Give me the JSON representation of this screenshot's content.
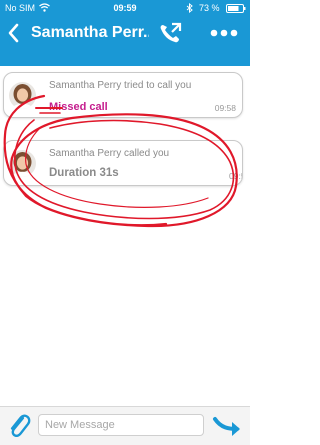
{
  "status": {
    "carrier": "No SIM",
    "time": "09:59",
    "battery": "73 %"
  },
  "header": {
    "title": "Samantha Perr...",
    "accent_color": "#1a98d5"
  },
  "messages": [
    {
      "text": "Samantha Perry tried to call you",
      "status": "Missed call",
      "time": "09:58",
      "status_color": "#c51e8e"
    },
    {
      "text": "Samantha Perry called you",
      "status": "Duration 31s",
      "time": "09:5"
    }
  ],
  "composer": {
    "placeholder": "New Message"
  },
  "icons": {
    "back": "chevron-left-icon",
    "call": "phone-icon",
    "more": "more-dots-icon",
    "attach": "paperclip-icon",
    "send": "send-arrow-icon",
    "wifi": "wifi-icon",
    "bluetooth": "bluetooth-icon"
  },
  "annotation_color": "#e0182a"
}
